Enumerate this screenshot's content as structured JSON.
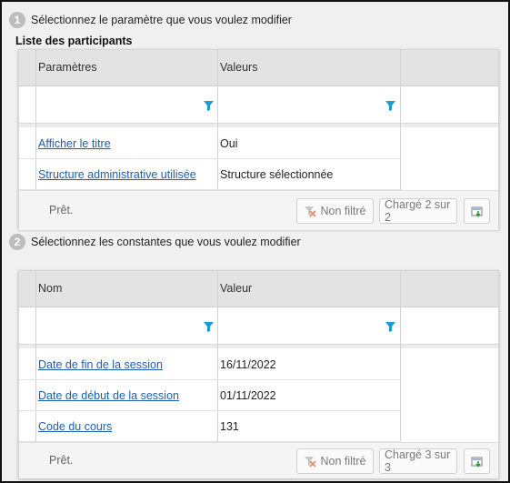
{
  "step1": {
    "number": "1",
    "text": "Sélectionnez le paramètre que vous voulez modifier"
  },
  "section1": {
    "title": "Liste des participants"
  },
  "grid1": {
    "columns": [
      "Paramètres",
      "Valeurs"
    ],
    "rows": [
      {
        "name": "Afficher le titre",
        "value": "Oui"
      },
      {
        "name": "Structure administrative utilisée",
        "value": "Structure sélectionnée"
      }
    ],
    "status": "Prêt.",
    "filter_button": "Non filtré",
    "loaded": "Chargé 2 sur 2"
  },
  "step2": {
    "number": "2",
    "text": "Sélectionnez les constantes que vous voulez modifier"
  },
  "grid2": {
    "columns": [
      "Nom",
      "Valeur"
    ],
    "rows": [
      {
        "name": "Date de fin de la session",
        "value": "16/11/2022"
      },
      {
        "name": "Date de début de la session",
        "value": "01/11/2022"
      },
      {
        "name": "Code du cours",
        "value": "131"
      }
    ],
    "status": "Prêt.",
    "filter_button": "Non filtré",
    "loaded": "Chargé 3 sur 3"
  },
  "icons": {
    "column_filter": "funnel-icon",
    "clear_filter": "funnel-clear-icon",
    "export": "export-icon"
  },
  "colors": {
    "link": "#1a5fb4",
    "filter_icon": "#1e9bd7",
    "header_bg": "#e3e3e3"
  }
}
